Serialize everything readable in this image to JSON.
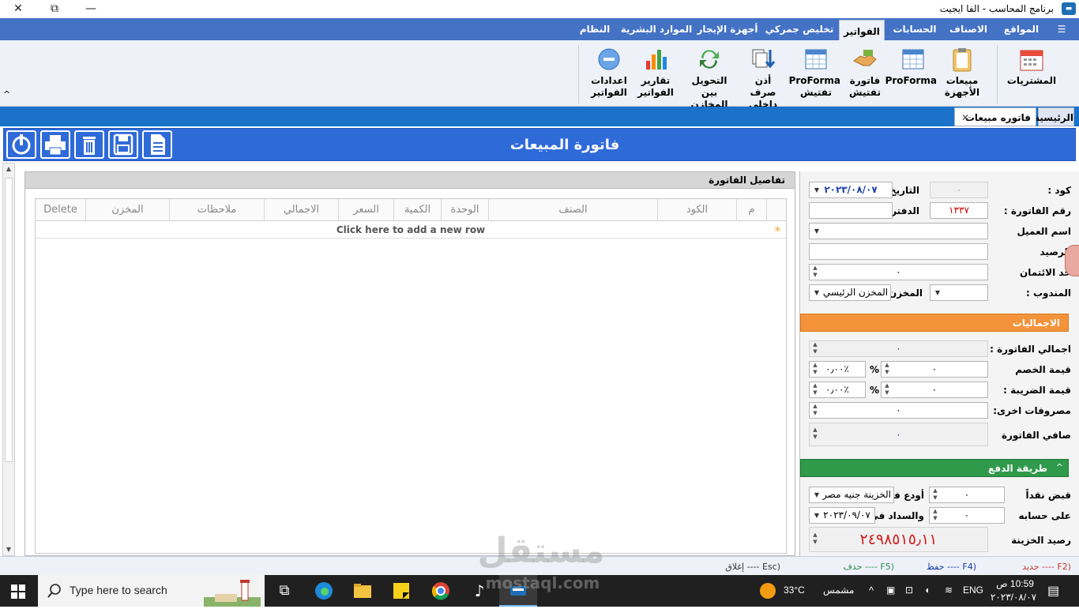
{
  "window": {
    "title": "برنامج المحاسب - الفا ايجيت",
    "close": "✕",
    "maximize": "⧉",
    "minimize": "—"
  },
  "ribbon_tabs": [
    "النظام",
    "الموارد البشرية",
    "أجهزة الإيجار",
    "تخليص جمركي",
    "الفواتير",
    "الحسابات",
    "الاصناف",
    "المواقع"
  ],
  "ribbon_active": "الفواتير",
  "ribbon_buttons": {
    "purchases": "المشتريات",
    "device_sales_1": "مبيعات",
    "device_sales_2": "الأجهزة",
    "proforma": "ProForma",
    "inspect_invoice_1": "فاتورة",
    "inspect_invoice_2": "تفتيش",
    "proforma_inspect_1": "ProForma",
    "proforma_inspect_2": "تفتيش",
    "issue_1": "أذن صرف",
    "issue_2": "داخلي",
    "transfer_1": "التحويل بين",
    "transfer_2": "المخازن",
    "reports_1": "تقارير",
    "reports_2": "الفواتير",
    "settings_1": "اعدادات",
    "settings_2": "الفواتير"
  },
  "doc_tabs": {
    "home": "الرئيسية",
    "sales_invoice": "فاتوره مبيعات",
    "close": "✕"
  },
  "form": {
    "title": "فاتورة المبيعات"
  },
  "grid": {
    "header": "تفاصيل الفاتورة",
    "columns": [
      "م",
      "الكود",
      "الصنف",
      "الوحدة",
      "الكمية",
      "السعر",
      "الاجمالي",
      "ملاحظات",
      "المخزن",
      "Delete"
    ],
    "new_row_hint": "Click here to add a new row",
    "new_row_marker": "✳"
  },
  "details": {
    "code_label": "كود :",
    "code_value": "٠",
    "date_label": "التاريخ :",
    "date_value": "٢٠٢٣/٠٨/٠٧",
    "invoice_no_label": "رقم الفاتورة :",
    "invoice_no_value": "١٣٣٧",
    "ledger_label": "الدفتري",
    "ledger_value": "",
    "customer_label": "اسم العميل",
    "customer_value": "",
    "balance_label": "الرصيد",
    "balance_value": "",
    "credit_label": "حد الائتمان",
    "credit_value": "٠",
    "rep_label": "المندوب :",
    "rep_value": "",
    "store_label": "المخزن :",
    "store_value": "المخزن الرئيسي"
  },
  "totals": {
    "header": "الاجماليات",
    "invoice_total_label": "اجمالي الفاتورة :",
    "invoice_total_value": "٠",
    "discount_label": "قيمة الخصم",
    "discount_value": "٠",
    "discount_pct": "٠٫٠٠٪",
    "tax_label": "قيمة الضريبة :",
    "tax_value": "٠",
    "tax_pct": "٠٫٠٠٪",
    "pct_sign": "%",
    "other_label": "مصروفات اخرى:",
    "other_value": "٠",
    "net_label": "صافي الفاتورة",
    "net_value": "٠"
  },
  "payment": {
    "header": "طريقة الدفع",
    "cash_label": "قبض نقداً",
    "cash_value": "٠",
    "deposit_label": "أودع في",
    "deposit_value": "الخزينة جنيه مصري",
    "account_label": "على حسابه",
    "account_value": "٠",
    "due_label": "والسداد في :",
    "due_value": "٢٠٢٣/٠٩/٠٧",
    "treasury_label": "رصيد الخزينة",
    "treasury_value": "٢٤٩٨٥١٥٫١١"
  },
  "shortcuts": {
    "new": "(F2 ---- جديد",
    "save": "(F4 ---- حفظ",
    "delete": "(F5 ---- حذف",
    "close": "(Esc ---- إغلاق"
  },
  "colors": {
    "ribbon_blue": "#4472c4",
    "header_blue": "#2f6ad9",
    "totals_orange": "#f4933a",
    "payment_green": "#2f9a4a",
    "treasury_red": "#d11f1f"
  },
  "watermark": {
    "arabic": "مستقل",
    "latin": "mostaql.com"
  },
  "taskbar": {
    "search_placeholder": "Type here to search",
    "temperature": "33°C",
    "weather": "مشمس",
    "lang": "ENG",
    "time": "10:59 ص",
    "date": "٢٠٢٣/٠٨/٠٧"
  }
}
